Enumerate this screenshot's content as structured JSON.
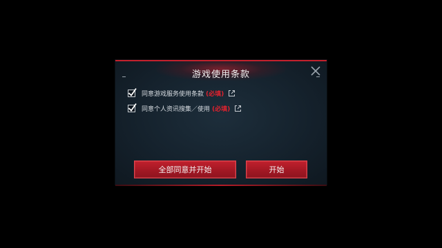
{
  "dialog": {
    "title": "游戏使用条款",
    "close_icon": "close-icon",
    "items": [
      {
        "label": "同意游戏服务使用条款",
        "required": "(必填)",
        "checked": true,
        "link_icon": "external-link-icon"
      },
      {
        "label": "同意个人资讯搜集／使用",
        "required": "(必填)",
        "checked": true,
        "link_icon": "external-link-icon"
      }
    ],
    "buttons": {
      "agree_all": "全部同意并开始",
      "start": "开始"
    }
  },
  "colors": {
    "accent_red": "#c4202c",
    "required_red": "#e0222e",
    "panel_bg": "#1a2834"
  }
}
